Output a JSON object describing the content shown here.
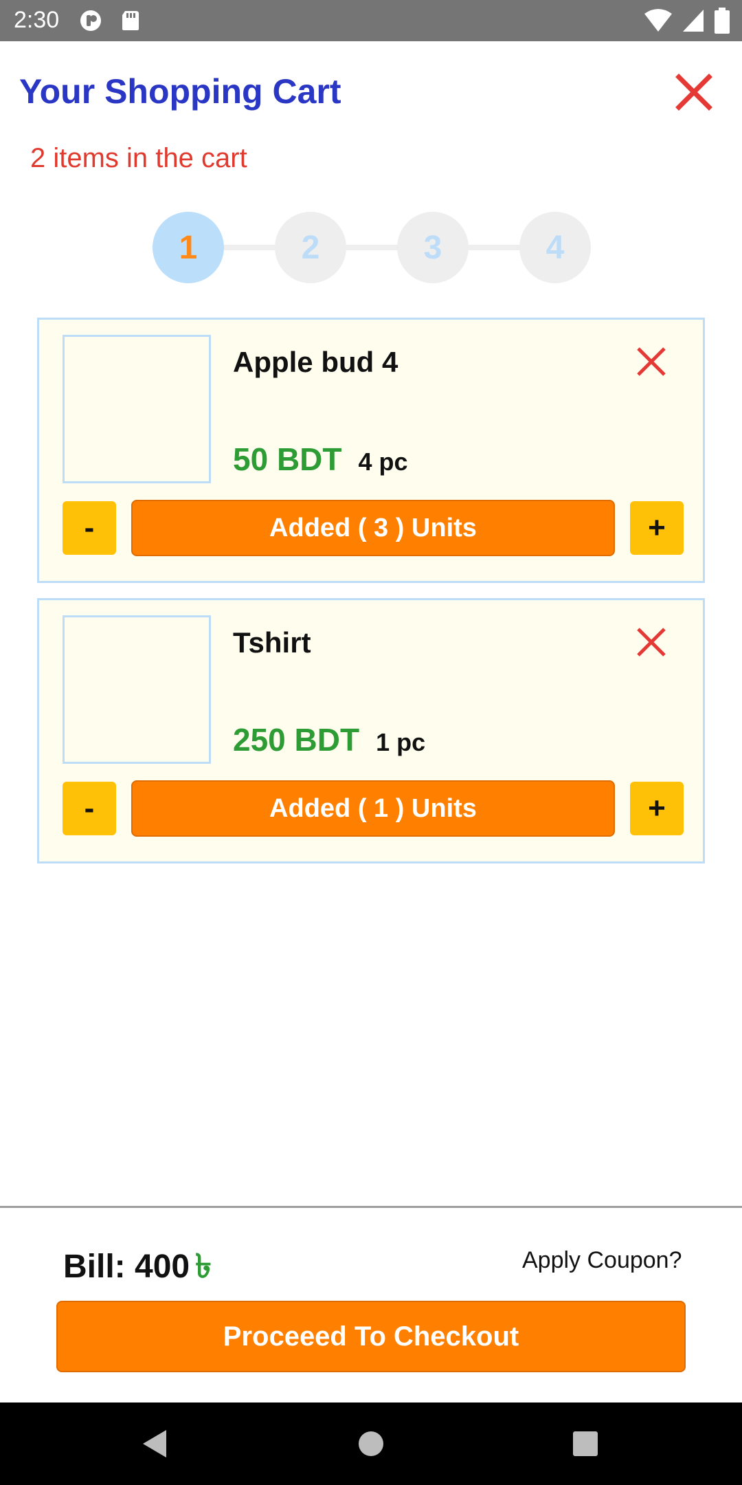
{
  "status_bar": {
    "time": "2:30",
    "left_icons": [
      "notification-icon",
      "sd-card-icon"
    ],
    "right_icons": [
      "wifi-icon",
      "cell-signal-icon",
      "battery-icon"
    ]
  },
  "header": {
    "title": "Your Shopping Cart",
    "close_icon": "close-icon"
  },
  "cart_summary": {
    "items_count_text": "2 items in the cart"
  },
  "stepper": {
    "steps": [
      "1",
      "2",
      "3",
      "4"
    ],
    "active_step": "1"
  },
  "items": [
    {
      "name": "Apple bud 4",
      "price": "50 BDT",
      "quantity": "4 pc",
      "minus_label": "-",
      "added_label": "Added ( 3 ) Units",
      "plus_label": "+"
    },
    {
      "name": "Tshirt",
      "price": "250 BDT",
      "quantity": "1 pc",
      "minus_label": "-",
      "added_label": "Added ( 1 ) Units",
      "plus_label": "+"
    }
  ],
  "footer": {
    "bill_label": "Bill: 400",
    "currency_symbol": "৳",
    "coupon_label": "Apply Coupon?",
    "checkout_label": "Proceeed To Checkout"
  },
  "navigation": {
    "icons": [
      "back-icon",
      "home-icon",
      "recents-icon"
    ]
  },
  "colors": {
    "title": "#2a36c4",
    "count_text": "#e03a2f",
    "price": "#2e9c34",
    "primary_button": "#ff8000",
    "stepper_button": "#ffc107",
    "card_background": "#fffdee",
    "card_border": "#bcdcf8"
  }
}
